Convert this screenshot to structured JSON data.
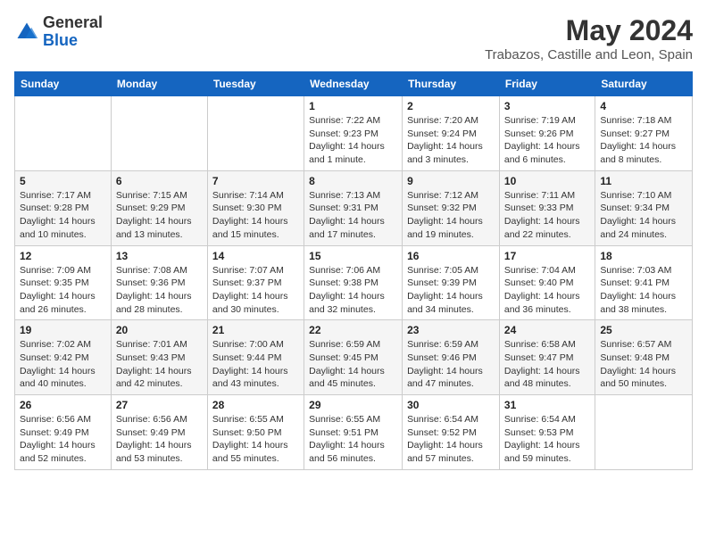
{
  "header": {
    "logo_general": "General",
    "logo_blue": "Blue",
    "month_title": "May 2024",
    "location": "Trabazos, Castille and Leon, Spain"
  },
  "weekdays": [
    "Sunday",
    "Monday",
    "Tuesday",
    "Wednesday",
    "Thursday",
    "Friday",
    "Saturday"
  ],
  "weeks": [
    [
      {
        "day": "",
        "info": ""
      },
      {
        "day": "",
        "info": ""
      },
      {
        "day": "",
        "info": ""
      },
      {
        "day": "1",
        "info": "Sunrise: 7:22 AM\nSunset: 9:23 PM\nDaylight: 14 hours\nand 1 minute."
      },
      {
        "day": "2",
        "info": "Sunrise: 7:20 AM\nSunset: 9:24 PM\nDaylight: 14 hours\nand 3 minutes."
      },
      {
        "day": "3",
        "info": "Sunrise: 7:19 AM\nSunset: 9:26 PM\nDaylight: 14 hours\nand 6 minutes."
      },
      {
        "day": "4",
        "info": "Sunrise: 7:18 AM\nSunset: 9:27 PM\nDaylight: 14 hours\nand 8 minutes."
      }
    ],
    [
      {
        "day": "5",
        "info": "Sunrise: 7:17 AM\nSunset: 9:28 PM\nDaylight: 14 hours\nand 10 minutes."
      },
      {
        "day": "6",
        "info": "Sunrise: 7:15 AM\nSunset: 9:29 PM\nDaylight: 14 hours\nand 13 minutes."
      },
      {
        "day": "7",
        "info": "Sunrise: 7:14 AM\nSunset: 9:30 PM\nDaylight: 14 hours\nand 15 minutes."
      },
      {
        "day": "8",
        "info": "Sunrise: 7:13 AM\nSunset: 9:31 PM\nDaylight: 14 hours\nand 17 minutes."
      },
      {
        "day": "9",
        "info": "Sunrise: 7:12 AM\nSunset: 9:32 PM\nDaylight: 14 hours\nand 19 minutes."
      },
      {
        "day": "10",
        "info": "Sunrise: 7:11 AM\nSunset: 9:33 PM\nDaylight: 14 hours\nand 22 minutes."
      },
      {
        "day": "11",
        "info": "Sunrise: 7:10 AM\nSunset: 9:34 PM\nDaylight: 14 hours\nand 24 minutes."
      }
    ],
    [
      {
        "day": "12",
        "info": "Sunrise: 7:09 AM\nSunset: 9:35 PM\nDaylight: 14 hours\nand 26 minutes."
      },
      {
        "day": "13",
        "info": "Sunrise: 7:08 AM\nSunset: 9:36 PM\nDaylight: 14 hours\nand 28 minutes."
      },
      {
        "day": "14",
        "info": "Sunrise: 7:07 AM\nSunset: 9:37 PM\nDaylight: 14 hours\nand 30 minutes."
      },
      {
        "day": "15",
        "info": "Sunrise: 7:06 AM\nSunset: 9:38 PM\nDaylight: 14 hours\nand 32 minutes."
      },
      {
        "day": "16",
        "info": "Sunrise: 7:05 AM\nSunset: 9:39 PM\nDaylight: 14 hours\nand 34 minutes."
      },
      {
        "day": "17",
        "info": "Sunrise: 7:04 AM\nSunset: 9:40 PM\nDaylight: 14 hours\nand 36 minutes."
      },
      {
        "day": "18",
        "info": "Sunrise: 7:03 AM\nSunset: 9:41 PM\nDaylight: 14 hours\nand 38 minutes."
      }
    ],
    [
      {
        "day": "19",
        "info": "Sunrise: 7:02 AM\nSunset: 9:42 PM\nDaylight: 14 hours\nand 40 minutes."
      },
      {
        "day": "20",
        "info": "Sunrise: 7:01 AM\nSunset: 9:43 PM\nDaylight: 14 hours\nand 42 minutes."
      },
      {
        "day": "21",
        "info": "Sunrise: 7:00 AM\nSunset: 9:44 PM\nDaylight: 14 hours\nand 43 minutes."
      },
      {
        "day": "22",
        "info": "Sunrise: 6:59 AM\nSunset: 9:45 PM\nDaylight: 14 hours\nand 45 minutes."
      },
      {
        "day": "23",
        "info": "Sunrise: 6:59 AM\nSunset: 9:46 PM\nDaylight: 14 hours\nand 47 minutes."
      },
      {
        "day": "24",
        "info": "Sunrise: 6:58 AM\nSunset: 9:47 PM\nDaylight: 14 hours\nand 48 minutes."
      },
      {
        "day": "25",
        "info": "Sunrise: 6:57 AM\nSunset: 9:48 PM\nDaylight: 14 hours\nand 50 minutes."
      }
    ],
    [
      {
        "day": "26",
        "info": "Sunrise: 6:56 AM\nSunset: 9:49 PM\nDaylight: 14 hours\nand 52 minutes."
      },
      {
        "day": "27",
        "info": "Sunrise: 6:56 AM\nSunset: 9:49 PM\nDaylight: 14 hours\nand 53 minutes."
      },
      {
        "day": "28",
        "info": "Sunrise: 6:55 AM\nSunset: 9:50 PM\nDaylight: 14 hours\nand 55 minutes."
      },
      {
        "day": "29",
        "info": "Sunrise: 6:55 AM\nSunset: 9:51 PM\nDaylight: 14 hours\nand 56 minutes."
      },
      {
        "day": "30",
        "info": "Sunrise: 6:54 AM\nSunset: 9:52 PM\nDaylight: 14 hours\nand 57 minutes."
      },
      {
        "day": "31",
        "info": "Sunrise: 6:54 AM\nSunset: 9:53 PM\nDaylight: 14 hours\nand 59 minutes."
      },
      {
        "day": "",
        "info": ""
      }
    ]
  ]
}
